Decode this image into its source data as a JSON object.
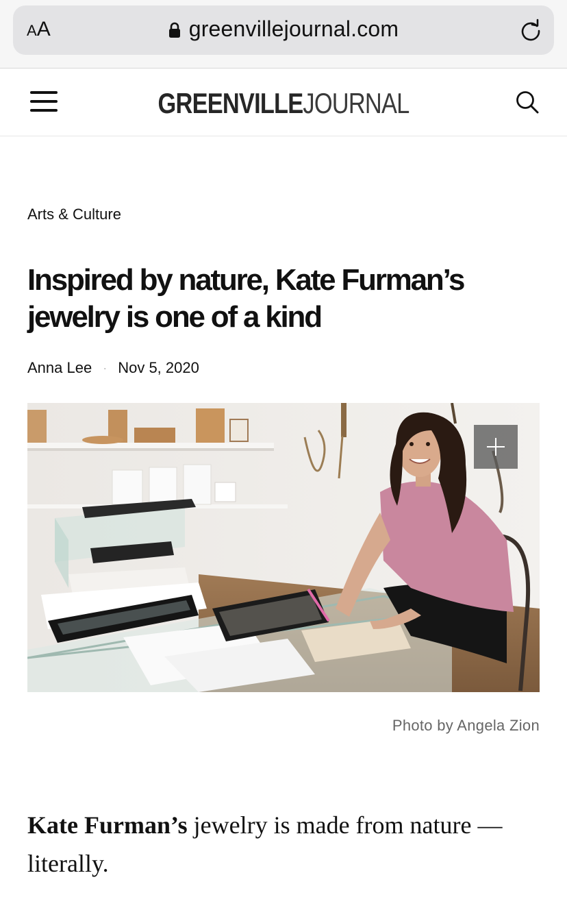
{
  "browser": {
    "reader_small": "A",
    "reader_large": "A",
    "url": "greenvillejournal.com"
  },
  "site": {
    "logo_bold": "GREENVILLE",
    "logo_light": "JOURNAL"
  },
  "article": {
    "category": "Arts & Culture",
    "title": "Inspired by nature, Kate Furman’s jewelry is one of a kind",
    "author": "Anna Lee",
    "separator": "·",
    "date": "Nov 5, 2020",
    "photo_credit": "Photo by Angela Zion",
    "lede_bold": "Kate Furman’s",
    "lede_rest": " jewelry is made from nature — literally."
  },
  "icons": {
    "lock": "lock-icon",
    "reload": "reload-icon",
    "menu": "menu-icon",
    "search": "search-icon",
    "expand": "plus-icon"
  },
  "colors": {
    "chrome_bg": "#f6f6f6",
    "url_pill": "#e3e3e5",
    "text": "#111111",
    "muted": "#666666",
    "shirt": "#c9879e"
  }
}
